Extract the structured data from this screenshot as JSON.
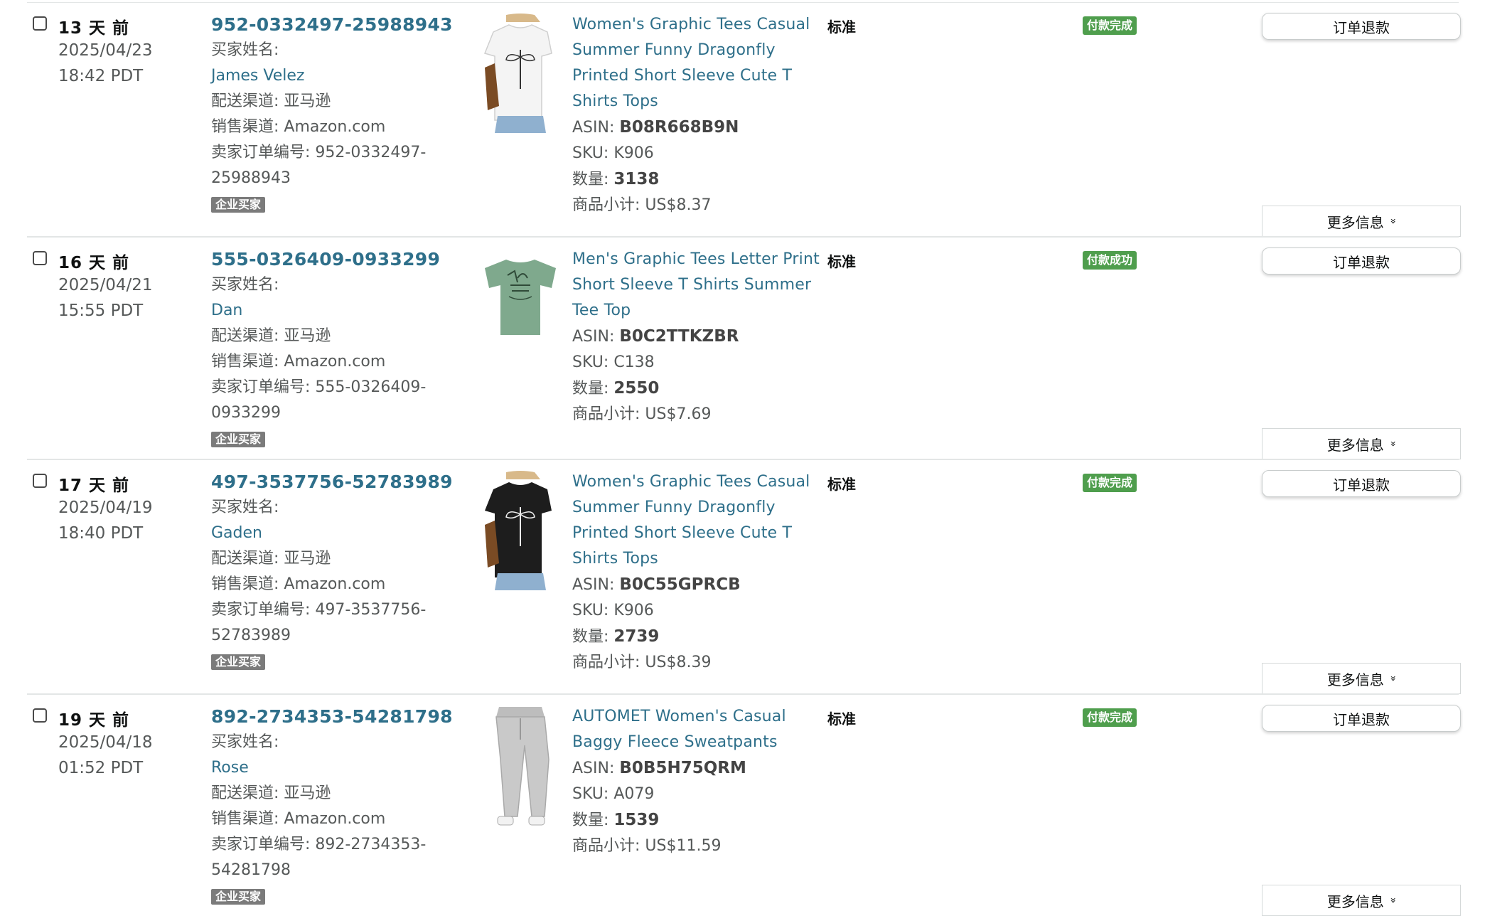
{
  "labels": {
    "buyer_name": "买家姓名:",
    "fulfillment": "配送渠道: 亚马逊",
    "sales_channel": "销售渠道: Amazon.com",
    "seller_order_id": "卖家订单编号: ",
    "business_buyer": "企业买家",
    "asin": "ASIN: ",
    "sku": "SKU: ",
    "quantity": "数量: ",
    "subtotal": "商品小计: ",
    "shipping_standard": "标准",
    "refund_button": "订单退款",
    "more_info": "更多信息",
    "more_info_icon": "»"
  },
  "orders": [
    {
      "days_ago": "13 天 前",
      "date": "2025/04/23",
      "time": "18:42 PDT",
      "order_id": "952-0332497-25988943",
      "buyer": "James Velez",
      "seller_order_line1": "952-0332497-",
      "seller_order_line2": "25988943",
      "title_lines": [
        "Women's Graphic Tees Casual",
        "Summer Funny Dragonfly",
        "Printed Short Sleeve Cute T",
        "Shirts Tops"
      ],
      "asin": "B08R668B9N",
      "sku": "K906",
      "qty": "3138",
      "subtotal": "US$8.37",
      "status": "付款完成",
      "image_icon": "white-tshirt-photo"
    },
    {
      "days_ago": "16 天 前",
      "date": "2025/04/21",
      "time": "15:55 PDT",
      "order_id": "555-0326409-0933299",
      "buyer": "Dan",
      "seller_order_line1": "555-0326409-",
      "seller_order_line2": "0933299",
      "title_lines": [
        "Men's Graphic Tees Letter Print",
        "Short Sleeve T Shirts Summer",
        "Tee Top"
      ],
      "asin": "B0C2TTKZBR",
      "sku": "C138",
      "qty": "2550",
      "subtotal": "US$7.69",
      "status": "付款成功",
      "image_icon": "green-tshirt-photo"
    },
    {
      "days_ago": "17 天 前",
      "date": "2025/04/19",
      "time": "18:40 PDT",
      "order_id": "497-3537756-52783989",
      "buyer": "Gaden",
      "seller_order_line1": "497-3537756-",
      "seller_order_line2": "52783989",
      "title_lines": [
        "Women's Graphic Tees Casual",
        "Summer Funny Dragonfly",
        "Printed Short Sleeve Cute T",
        "Shirts Tops"
      ],
      "asin": "B0C55GPRCB",
      "sku": "K906",
      "qty": "2739",
      "subtotal": "US$8.39",
      "status": "付款完成",
      "image_icon": "black-tshirt-photo"
    },
    {
      "days_ago": "19 天 前",
      "date": "2025/04/18",
      "time": "01:52 PDT",
      "order_id": "892-2734353-54281798",
      "buyer": "Rose",
      "seller_order_line1": "892-2734353-",
      "seller_order_line2": "54281798",
      "title_lines": [
        "AUTOMET Women's Casual",
        "Baggy Fleece Sweatpants"
      ],
      "asin": "B0B5H75QRM",
      "sku": "A079",
      "qty": "1539",
      "subtotal": "US$11.59",
      "status": "付款完成",
      "image_icon": "grey-sweatpants-photo"
    }
  ],
  "colors": {
    "link": "#2e6f8a",
    "status_green": "#4f9e4d",
    "business_badge": "#7b7b7b"
  }
}
